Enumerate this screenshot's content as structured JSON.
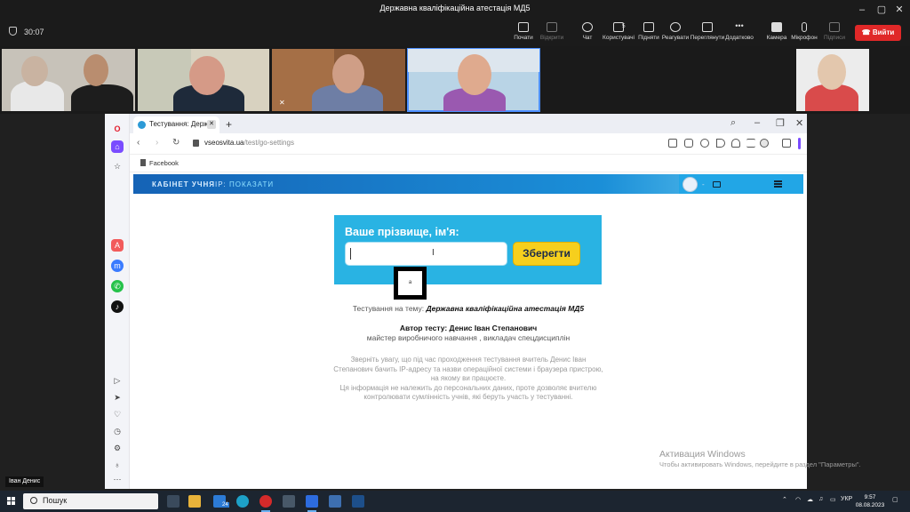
{
  "window": {
    "title": "Державна кваліфікаційна атестація МД5"
  },
  "meeting": {
    "timer": "30:07"
  },
  "toolbar": {
    "share": "Почати",
    "record": "Відкрити",
    "chat": "Чат",
    "participants": "Користувачі",
    "participants_count": "5",
    "raise": "Підняти",
    "react": "Реагувати",
    "view": "Переглянути",
    "more": "Додатково",
    "camera": "Камера",
    "mic": "Мікрофон",
    "captions": "Підписи",
    "leave": "Вийти"
  },
  "browser": {
    "tab_title": "Тестування: Держав",
    "url_domain": "vseosvita.ua",
    "url_path": "/test/go-settings",
    "bookmark": "Facebook"
  },
  "site": {
    "cabinet": "КАБІНЕТ УЧНЯ",
    "ip_label": "IP:",
    "ip_show": "ПОКАЗАТИ",
    "dash": "-"
  },
  "form": {
    "label": "Ваше прізвище, ім'я:",
    "input_value": "",
    "save": "Зберегти"
  },
  "tooltip": "а",
  "test": {
    "theme_prefix": "Тестування на тему:",
    "theme": "Державна кваліфікаційна атестація МД5",
    "author": "Автор тесту: Денис Іван Степанович",
    "author_role": "майстер виробничого навчання , викладач спецдисциплін"
  },
  "notice": {
    "line1": "Зверніть увагу, що під час проходження тестування вчитель Денис Іван Степанович бачить IP-адресу та назви операційної системи і браузера пристрою, на якому ви працюєте.",
    "line2": "Ця інформація не належить до персональних даних, проте дозволяє вчителю контролювати сумлінність учнів, які беруть участь у тестуванні."
  },
  "watermark": {
    "title": "Активация Windows",
    "text": "Чтобы активировать Windows, перейдите в раздел \"Параметры\"."
  },
  "speaker_name": "Іван Денис",
  "taskbar": {
    "search": "Пошук",
    "lang": "УКР",
    "time": "9:57",
    "date": "08.08.2023",
    "mail_badge": "24"
  }
}
